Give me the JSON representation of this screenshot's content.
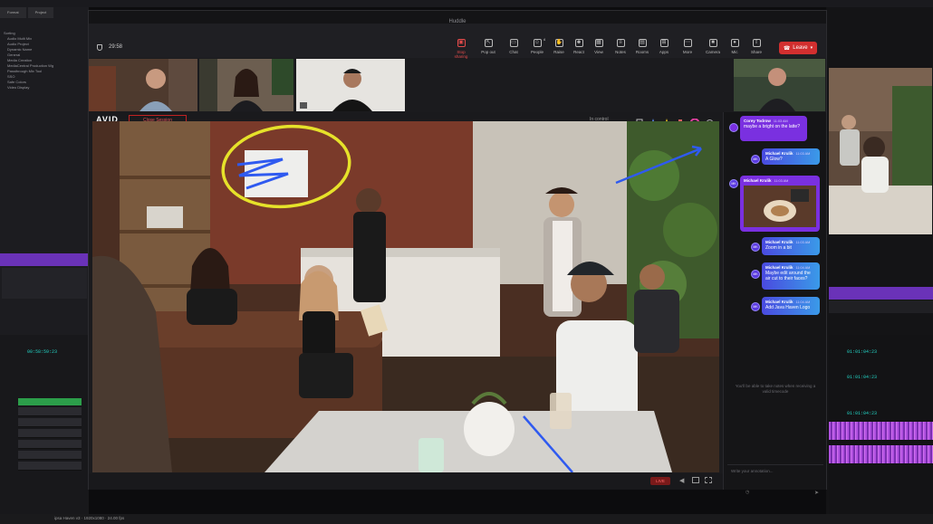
{
  "background": {
    "tabs": [
      "Format",
      "Project"
    ],
    "bins": [
      "Sorting",
      "Audio Multi Mix",
      "Audio Project",
      "Dynamic Name",
      "General",
      "Media Creation",
      "MediaCentral Production Wg",
      "Passthrough Mix Tool",
      "SSO",
      "Safe Colors",
      "Video Display"
    ],
    "timecode_left": "00:58:59:23",
    "timecode_right": [
      "01:01:04:23",
      "01:01:04:23",
      "01:01:04:23"
    ],
    "bottom_status": "ipsa Haven v3 · 1920x1080 · 24.00 fps"
  },
  "window": {
    "title": "Huddle",
    "timer": "29:58",
    "toolbar": [
      {
        "label": "Stop sharing",
        "icon": "share-stop-icon",
        "active": true
      },
      {
        "label": "Pop out",
        "icon": "pop-out-icon"
      },
      {
        "label": "Chat",
        "icon": "chat-icon"
      },
      {
        "label": "People",
        "icon": "people-icon",
        "badge": "4"
      },
      {
        "label": "Raise",
        "icon": "hand-icon"
      },
      {
        "label": "React",
        "icon": "react-icon"
      },
      {
        "label": "View",
        "icon": "view-icon"
      },
      {
        "label": "Notes",
        "icon": "notes-icon"
      },
      {
        "label": "Rooms",
        "icon": "rooms-icon"
      },
      {
        "label": "Apps",
        "icon": "apps-icon"
      },
      {
        "label": "More",
        "icon": "more-icon"
      },
      {
        "label": "Camera",
        "icon": "camera-icon"
      },
      {
        "label": "Mic",
        "icon": "mic-icon"
      },
      {
        "label": "Share",
        "icon": "share-icon"
      }
    ],
    "leave_label": "Leave"
  },
  "avid": {
    "logo": "AVID",
    "close_session": "Close Session",
    "in_control": "In control"
  },
  "chat": {
    "messages": [
      {
        "name": "Corey Todrow",
        "time": "11:03 AM",
        "text": "maybe a bright on the latte?",
        "style": "purple"
      },
      {
        "name": "Michael Krulik",
        "time": "11:03 AM",
        "text": "A Glow?",
        "style": "blue"
      },
      {
        "name": "Michael Krulik",
        "time": "11:03 AM",
        "text": "",
        "style": "purple-image"
      },
      {
        "name": "Michael Krulik",
        "time": "11:03 AM",
        "text": "Zoom in a bit",
        "style": "blue"
      },
      {
        "name": "Michael Krulik",
        "time": "11:04 AM",
        "text": "Maybe edit around the air cut to their faces?",
        "style": "blue"
      },
      {
        "name": "Michael Krulik",
        "time": "11:04 AM",
        "text": "Add Java Haven Logo",
        "style": "blue"
      }
    ],
    "avatar_initials": "MK",
    "notes_hint": "You'll be able to take notes when receiving a valid timecode",
    "input_placeholder": "Write your annotation..."
  },
  "video_bar": {
    "live": "LIVE"
  },
  "colors": {
    "accent": "#7a30e0",
    "leave": "#d22f2f",
    "timecode": "#23d3c4"
  }
}
